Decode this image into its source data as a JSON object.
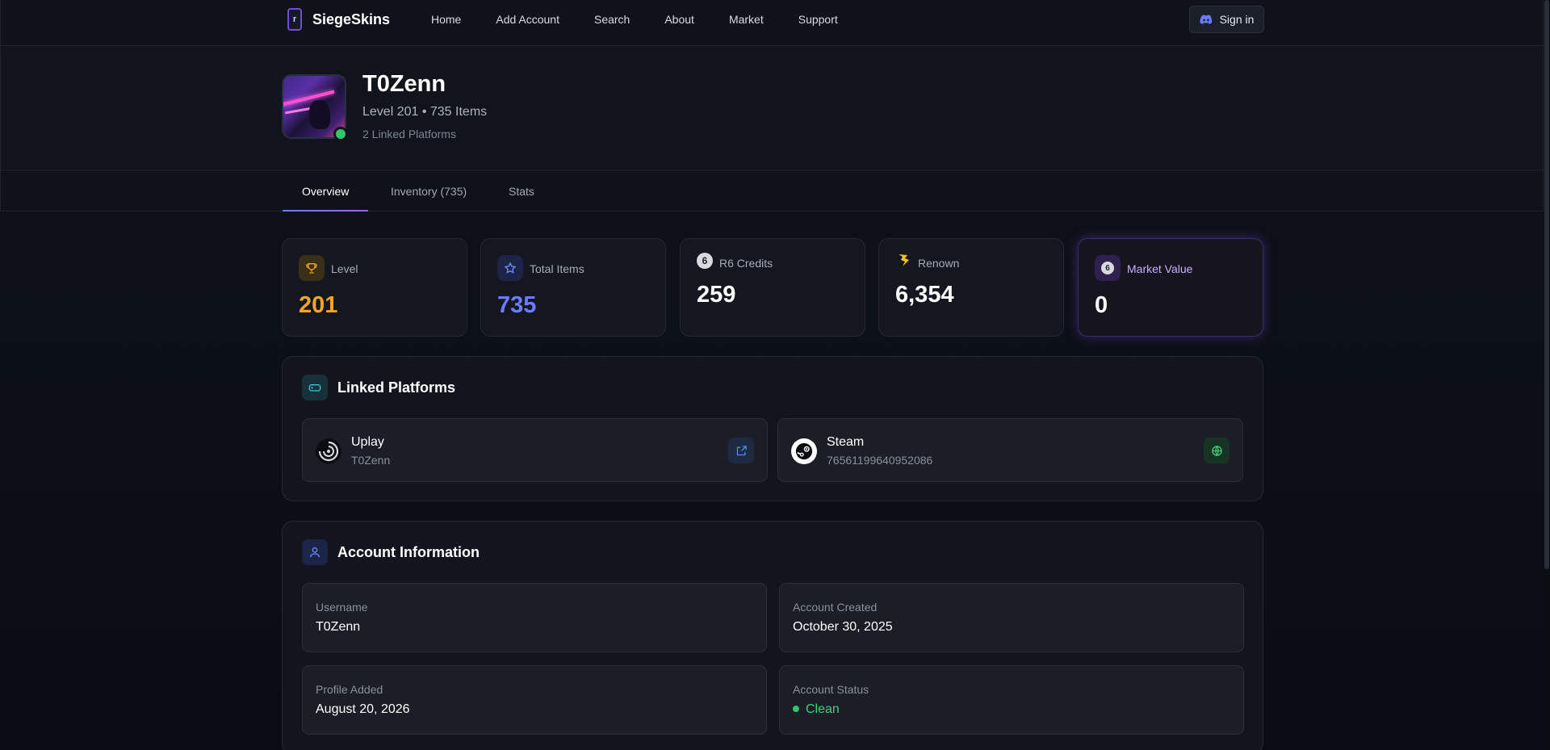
{
  "nav": {
    "brand": "SiegeSkins",
    "links": [
      "Home",
      "Add Account",
      "Search",
      "About",
      "Market",
      "Support"
    ],
    "signin_label": "Sign in"
  },
  "profile": {
    "name": "T0Zenn",
    "subtitle": "Level 201 • 735 Items",
    "platforms_text": "2 Linked Platforms",
    "online": true
  },
  "tabs": [
    {
      "label": "Overview",
      "active": true
    },
    {
      "label": "Inventory (735)",
      "active": false
    },
    {
      "label": "Stats",
      "active": false
    }
  ],
  "stats": [
    {
      "icon": "trophy-icon",
      "label": "Level",
      "value": "201",
      "color": "#f3a623"
    },
    {
      "icon": "star-icon",
      "label": "Total Items",
      "value": "735",
      "color": "#6b7cff"
    },
    {
      "icon": "r6-credits-icon",
      "label": "R6 Credits",
      "value": "259",
      "color": "#ffffff"
    },
    {
      "icon": "renown-icon",
      "label": "Renown",
      "value": "6,354",
      "color": "#ffffff"
    },
    {
      "icon": "market-value-icon",
      "label": "Market Value",
      "value": "0",
      "color": "#ffffff"
    }
  ],
  "linked_platforms": {
    "title": "Linked Platforms",
    "items": [
      {
        "name": "Uplay",
        "id": "T0Zenn",
        "action_icon": "external-link-icon"
      },
      {
        "name": "Steam",
        "id": "76561199640952086",
        "action_icon": "globe-icon"
      }
    ]
  },
  "account_info": {
    "title": "Account Information",
    "fields": [
      {
        "label": "Username",
        "value": "T0Zenn"
      },
      {
        "label": "Account Created",
        "value": "October 30, 2025"
      },
      {
        "label": "Profile Added",
        "value": "August 20, 2026"
      },
      {
        "label": "Account Status",
        "value": "Clean"
      }
    ]
  },
  "colors": {
    "accent_purple": "#8b5cf6",
    "accent_blue": "#6b7cff",
    "level_gold": "#f3a623",
    "status_green": "#3fd27a"
  }
}
